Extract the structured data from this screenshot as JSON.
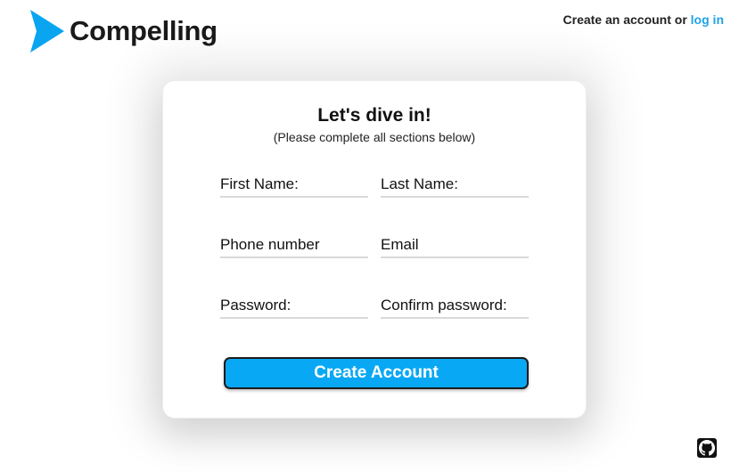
{
  "header": {
    "brand": "Compelling",
    "account_prefix": "Create an account or",
    "login_link": "log in"
  },
  "card": {
    "title": "Let's dive in!",
    "subtitle": "(Please complete all sections below)",
    "fields": {
      "first_name": {
        "placeholder": "First Name:",
        "value": ""
      },
      "last_name": {
        "placeholder": "Last Name:",
        "value": ""
      },
      "phone": {
        "placeholder": "Phone number",
        "value": ""
      },
      "email": {
        "placeholder": "Email",
        "value": ""
      },
      "password": {
        "placeholder": "Password:",
        "value": ""
      },
      "confirm_password": {
        "placeholder": "Confirm password:",
        "value": ""
      }
    },
    "submit_label": "Create Account"
  },
  "footer": {
    "github_icon": "github-icon"
  },
  "colors": {
    "accent": "#08a8f4",
    "link": "#1fa3e6",
    "logo_blue": "#0aa5f0"
  }
}
